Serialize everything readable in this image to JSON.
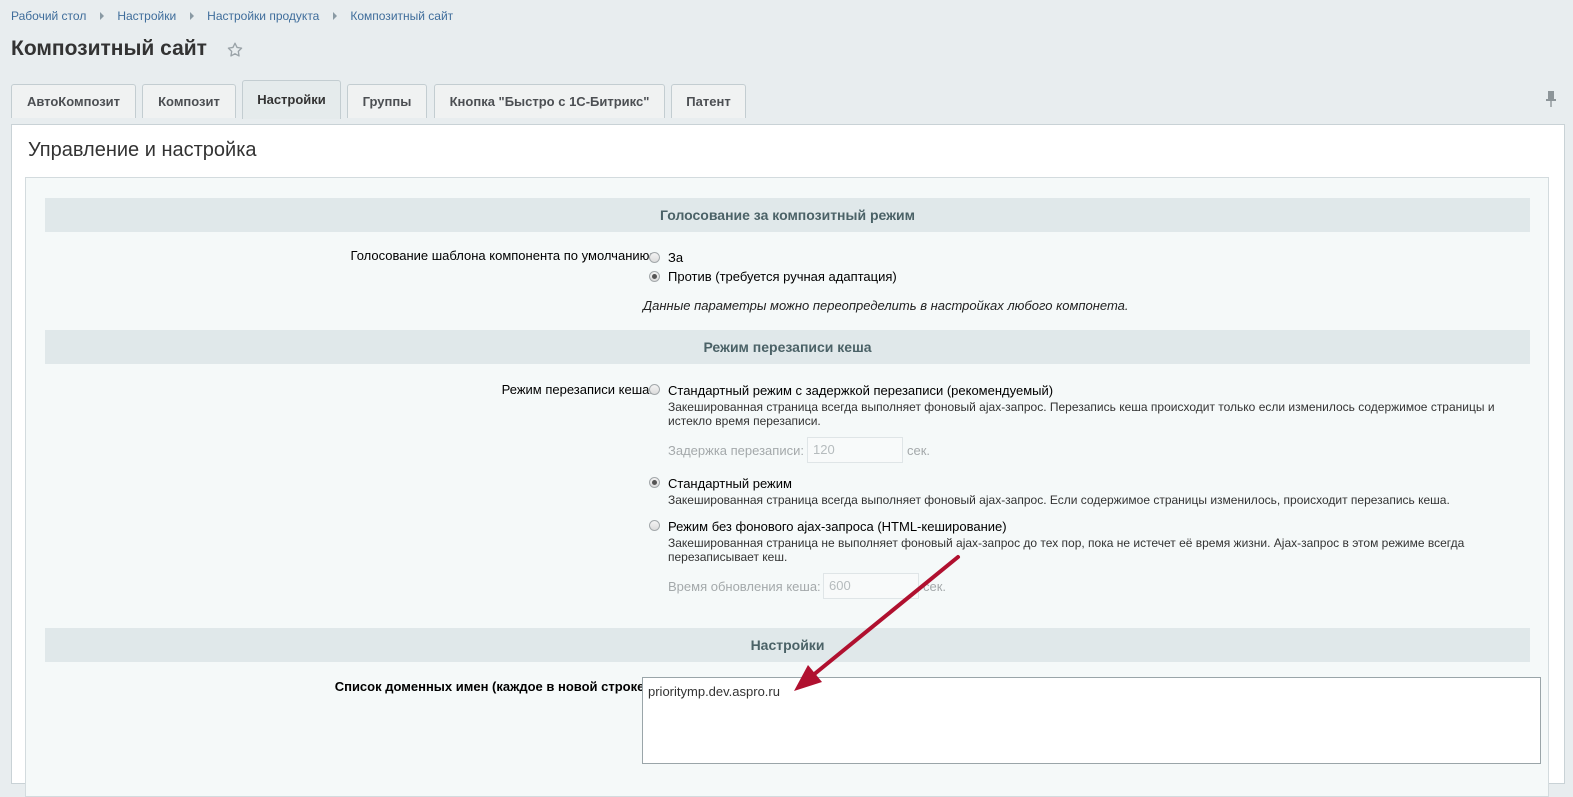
{
  "breadcrumb": [
    "Рабочий стол",
    "Настройки",
    "Настройки продукта",
    "Композитный сайт"
  ],
  "page_title": "Композитный сайт",
  "tabs": [
    {
      "label": "АвтоКомпозит"
    },
    {
      "label": "Композит"
    },
    {
      "label": "Настройки"
    },
    {
      "label": "Группы"
    },
    {
      "label": "Кнопка \"Быстро с 1С-Битрикс\""
    },
    {
      "label": "Патент"
    }
  ],
  "section_title": "Управление и настройка",
  "voting": {
    "header": "Голосование за композитный режим",
    "label": "Голосование шаблона компонента по умолчанию:",
    "option_for": "За",
    "option_against": "Против (требуется ручная адаптация)",
    "note": "Данные параметры можно переопределить в настройках любого компонета."
  },
  "cache_mode": {
    "header": "Режим перезаписи кеша",
    "label": "Режим перезаписи кеша:",
    "opt1_title": "Стандартный режим с задержкой перезаписи (рекомендуемый)",
    "opt1_desc": "Закешированная страница всегда выполняет фоновый ajax-запрос. Перезапись кеша происходит только если изменилось содержимое страницы и истекло время перезаписи.",
    "delay_label": "Задержка перезаписи:",
    "delay_value": "120",
    "delay_unit": "сек.",
    "opt2_title": "Стандартный режим",
    "opt2_desc": "Закешированная страница всегда выполняет фоновый ajax-запрос. Если содержимое страницы изменилось, происходит перезапись кеша.",
    "opt3_title": "Режим без фонового ajax-запроса (HTML-кеширование)",
    "opt3_desc": "Закешированная страница не выполняет фоновый ajax-запрос до тех пор, пока не истечет её время жизни. Ajax-запрос в этом режиме всегда перезаписывает кеш.",
    "update_label": "Время обновления кеша:",
    "update_value": "600",
    "update_unit": "сек."
  },
  "settings": {
    "header": "Настройки",
    "domains_label": "Список доменных имен (каждое в новой строке):",
    "domains_value": "prioritymp.dev.aspro.ru"
  },
  "colors": {
    "accent_arrow": "#b0102f",
    "link": "#3f6d9b"
  }
}
